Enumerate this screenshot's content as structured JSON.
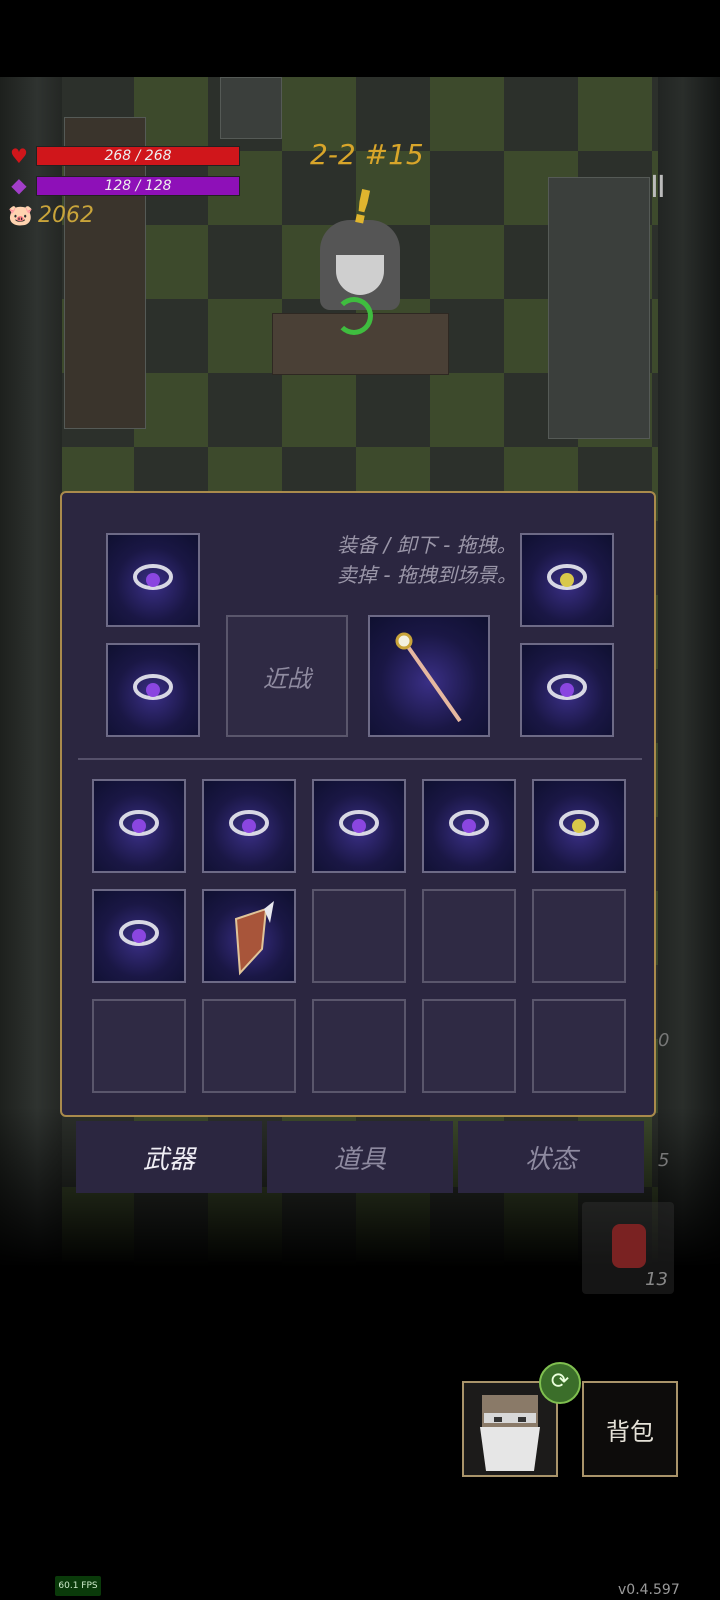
{
  "hud": {
    "hp": "268 / 268",
    "hp_fraction": 1.0,
    "mp": "128 / 128",
    "mp_fraction": 1.0,
    "gold": "2062",
    "level": "2-2 #15",
    "pause_symbol": "II",
    "colors": {
      "hp": "#d0161b",
      "mp": "#8e10b8",
      "gold": "#c9a43a"
    }
  },
  "panel": {
    "hint_line1": "装备 / 卸下 - 拖拽。",
    "hint_line2": "卖掉 - 拖拽到场景。",
    "melee_label": "近战",
    "equipped": [
      "ring-purple-swirl-icon",
      "ring-yellow-icon",
      "ring-purple-chevron-icon",
      "ring-purple-crescent-icon",
      "gold-staff-icon"
    ],
    "inventory": [
      "ring-purple-flower-icon",
      "ring-purple-flower-icon",
      "ring-purple-flower-icon",
      "ring-purple-flower-icon",
      "ring-yellow-icon",
      "ring-purple-wave-icon",
      "winged-shield-icon",
      "",
      "",
      "",
      "",
      "",
      "",
      "",
      ""
    ]
  },
  "tabs": {
    "weapons": "武器",
    "items": "道具",
    "status": "状态"
  },
  "side": {
    "num_a": "0",
    "num_b": "5",
    "potion_count": "13"
  },
  "footer": {
    "bag": "背包",
    "fps": "60.1 FPS",
    "version": "v0.4.597"
  }
}
